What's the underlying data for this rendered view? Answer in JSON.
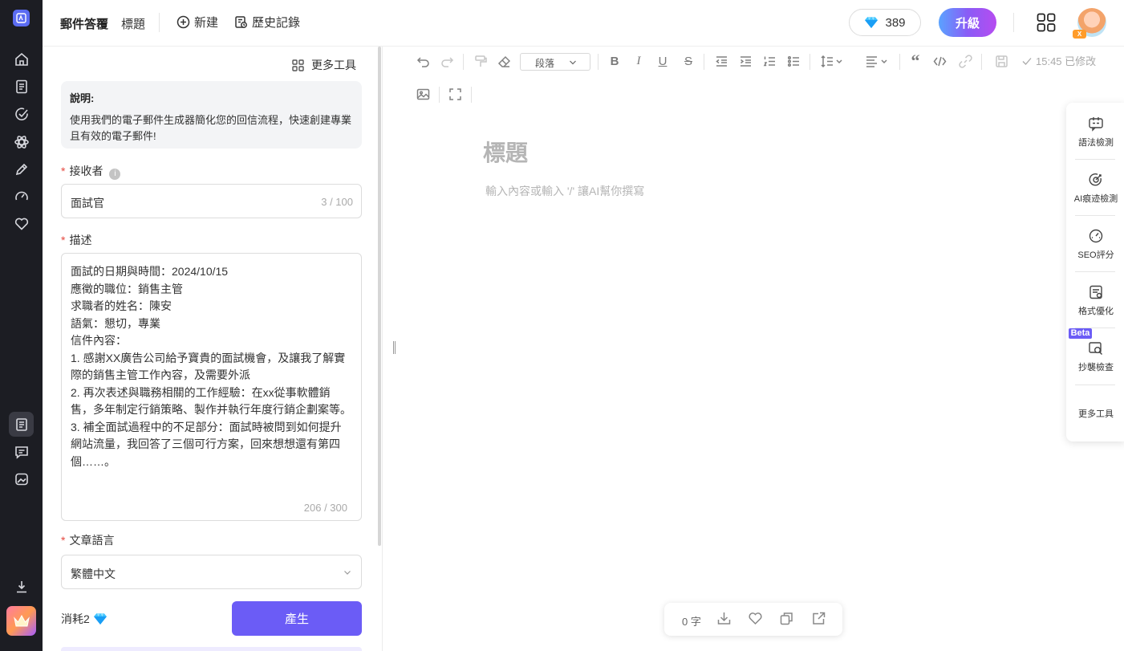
{
  "header": {
    "app_name": "郵件答覆",
    "title_tab": "標題",
    "new_label": "新建",
    "history_label": "歷史記錄",
    "gems": "389",
    "upgrade_label": "升級",
    "avatar_badge": "X"
  },
  "panel": {
    "more_tools": "更多工具",
    "description_heading": "說明:",
    "description_text": "使用我們的電子郵件生成器簡化您的回信流程，快速創建專業且有效的電子郵件!",
    "recipient_label": "接收者",
    "recipient_value": "面試官",
    "recipient_count": "3 / 100",
    "desc_label": "描述",
    "desc_value": "面試的日期與時間：2024/10/15\n應徵的職位：銷售主管\n求職者的姓名：陳安\n語氣：懇切，專業\n信件內容：\n1. 感謝XX廣告公司給予寶貴的面試機會，及讓我了解實際的銷售主管工作內容，及需要外派\n2. 再次表述與職務相關的工作經驗：在xx從事軟體銷售，多年制定行銷策略、製作并執行年度行銷企劃案等。\n3. 補全面試過程中的不足部分：面試時被問到如何提升網站流量，我回答了三個可行方案，回來想想還有第四個……。",
    "desc_count": "206 / 300",
    "lang_label": "文章語言",
    "lang_value": "繁體中文",
    "cost_label": "消耗2",
    "generate_label": "產生"
  },
  "editor": {
    "paragraph_select": "段落",
    "saved_status": "15:45 已修改",
    "title_placeholder": "標題",
    "body_placeholder": "輸入內容或輸入 '/' 讓AI幫你撰寫"
  },
  "right_tools": {
    "items": [
      {
        "label": "語法檢測",
        "icon": "grammar-icon"
      },
      {
        "label": "AI痕迹檢測",
        "icon": "ai-detect-icon"
      },
      {
        "label": "SEO評分",
        "icon": "seo-gauge-icon"
      },
      {
        "label": "格式優化",
        "icon": "format-icon"
      },
      {
        "label": "抄襲檢查",
        "icon": "plagiarism-icon"
      },
      {
        "label": "更多工具",
        "icon": ""
      }
    ],
    "beta_badge": "Beta"
  },
  "bottom_bar": {
    "word_count": "0 字"
  },
  "colors": {
    "rail_bg": "#1c1d23",
    "accent": "#6b5cf6",
    "required": "#e5483f"
  }
}
